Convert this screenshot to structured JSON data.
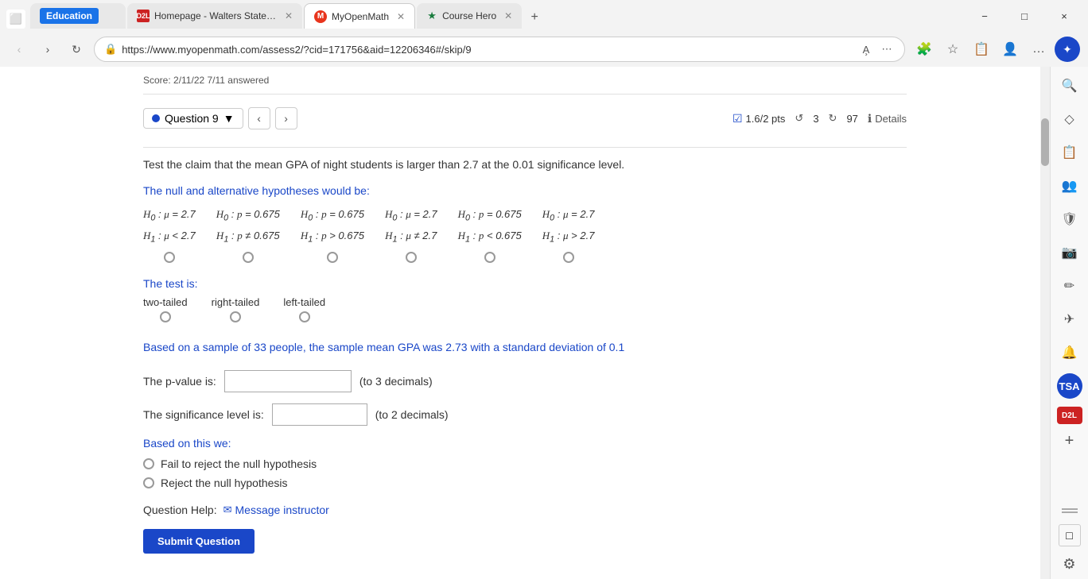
{
  "browser": {
    "tabs": [
      {
        "id": "education",
        "label": "Education",
        "active": false,
        "closable": false,
        "badge": "Education"
      },
      {
        "id": "d2l",
        "label": "Homepage - Walters State Com...",
        "active": false,
        "closable": true,
        "favicon": "D2L"
      },
      {
        "id": "myopenmath",
        "label": "MyOpenMath",
        "active": true,
        "closable": true,
        "favicon": "M"
      },
      {
        "id": "coursehero",
        "label": "Course Hero",
        "active": false,
        "closable": true,
        "favicon": "★"
      }
    ],
    "url": "https://www.myopenmath.com/assess2/?cid=171756&aid=12206346#/skip/9",
    "window_controls": [
      "−",
      "□",
      "×"
    ]
  },
  "question": {
    "selector_label": "Question 9",
    "score": "1.6/2 pts",
    "retries": "3",
    "attempts": "97",
    "details_label": "Details",
    "score_header": "Score: 2/11/22    7/11 answered"
  },
  "problem": {
    "statement": "Test the claim that the mean GPA of night students is larger than 2.7 at the 0.01 significance level.",
    "hypotheses_label": "The null and alternative hypotheses would be:",
    "hypotheses": [
      {
        "h0": "H₀ : μ = 2.7",
        "h1": "H₁ : μ < 2.7"
      },
      {
        "h0": "H₀ : p = 0.675",
        "h1": "H₁ : p ≠ 0.675"
      },
      {
        "h0": "H₀ : p = 0.675",
        "h1": "H₁ : p > 0.675"
      },
      {
        "h0": "H₀ : μ = 2.7",
        "h1": "H₁ : μ ≠ 2.7"
      },
      {
        "h0": "H₀ : p = 0.675",
        "h1": "H₁ : p < 0.675"
      },
      {
        "h0": "H₀ : μ = 2.7",
        "h1": "H₁ : μ > 2.7"
      }
    ],
    "test_is_label": "The test is:",
    "test_options": [
      "two-tailed",
      "right-tailed",
      "left-tailed"
    ],
    "sample_info": "Based on a sample of 33 people, the sample mean GPA was 2.73 with a standard deviation of 0.1",
    "pvalue_label": "The p-value is:",
    "pvalue_hint": "(to 3 decimals)",
    "sig_level_label": "The significance level is:",
    "sig_level_hint": "(to 2 decimals)",
    "based_label": "Based on this we:",
    "based_options": [
      "Fail to reject the null hypothesis",
      "Reject the null hypothesis"
    ],
    "help_label": "Question Help:",
    "message_instructor": "Message instructor",
    "submit_label": "Submit Question"
  },
  "icons": {
    "back": "‹",
    "forward": "›",
    "refresh": "↻",
    "lock": "🔒",
    "settings": "⚙",
    "star": "☆",
    "profile": "👤",
    "menu": "…",
    "close": "✕",
    "minimize": "−",
    "maximize": "□",
    "search": "🔍",
    "copilot": "✦",
    "mail": "✉",
    "info": "ℹ",
    "add": "+",
    "sidebar_icons": [
      "🔍",
      "◇",
      "📋",
      "👥",
      "🛡",
      "📷",
      "✏",
      "✈",
      "🔔"
    ]
  },
  "sidebar_right": {
    "icons": [
      "🔍",
      "◇",
      "📋",
      "👥",
      "🛡",
      "📷",
      "✏",
      "✈",
      "🔔",
      "TSA",
      "D2L",
      "+",
      "—",
      "□",
      "⚙"
    ]
  }
}
